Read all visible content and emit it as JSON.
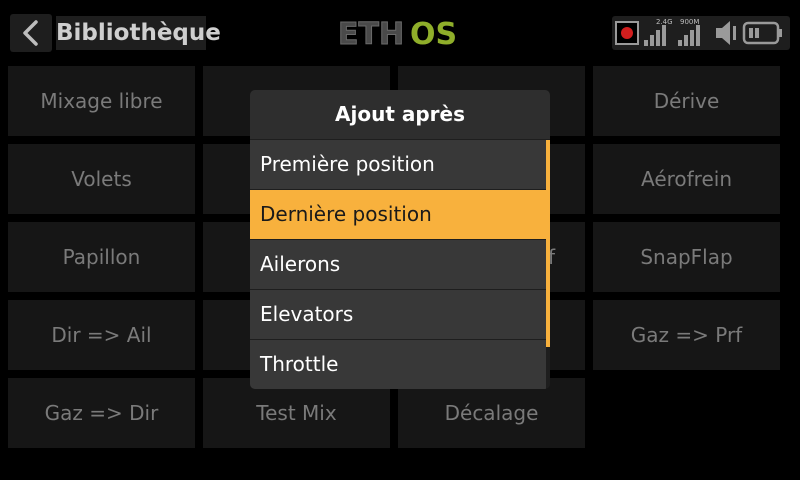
{
  "header": {
    "title": "Bibliothèque",
    "logo_text": "ETHOS",
    "status": {
      "signal1_label": "2.4G",
      "signal2_label": "900M"
    }
  },
  "grid": {
    "cells": [
      "Mixage libre",
      "Dérive",
      "Volets",
      "Aérofrein",
      "Papillon",
      "SnapFlap",
      "Dir => Ail",
      "Gaz => Prf",
      "Gaz => Dir",
      "Test Mix",
      "Décalage"
    ],
    "partial": [
      "f"
    ]
  },
  "modal": {
    "title": "Ajout après",
    "options": [
      "Première position",
      "Dernière position",
      "Ailerons",
      "Elevators",
      "Throttle"
    ],
    "selected_index": 1
  },
  "colors": {
    "accent": "#f8b13d",
    "logo_eth": "#4a4a4a",
    "logo_os": "#8fae2a"
  }
}
